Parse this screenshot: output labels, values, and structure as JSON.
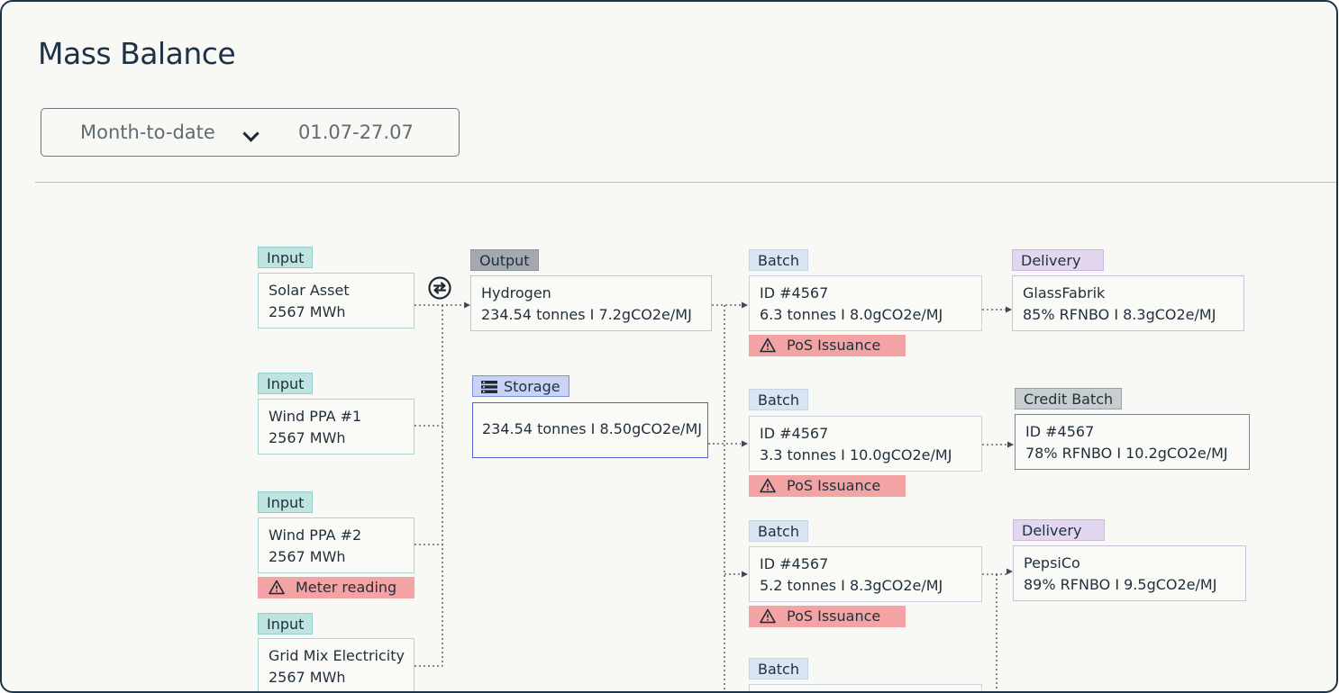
{
  "page": {
    "title": "Mass Balance"
  },
  "filter": {
    "period": "Month-to-date",
    "range": "01.07-27.07"
  },
  "inputs": [
    {
      "tag": "Input",
      "name": "Solar Asset",
      "value": "2567 MWh"
    },
    {
      "tag": "Input",
      "name": "Wind PPA #1",
      "value": "2567 MWh"
    },
    {
      "tag": "Input",
      "name": "Wind PPA #2",
      "value": "2567 MWh",
      "alert": "Meter reading"
    },
    {
      "tag": "Input",
      "name": "Grid Mix Electricity",
      "value": "2567 MWh"
    }
  ],
  "output": {
    "tag": "Output",
    "name": "Hydrogen",
    "value": "234.54 tonnes I 7.2gCO2e/MJ"
  },
  "storage": {
    "tag": "Storage",
    "value": "234.54 tonnes I 8.50gCO2e/MJ"
  },
  "batches": [
    {
      "tag": "Batch",
      "id": "ID #4567",
      "value": "6.3 tonnes I 8.0gCO2e/MJ",
      "alert": "PoS Issuance"
    },
    {
      "tag": "Batch",
      "id": "ID #4567",
      "value": "3.3 tonnes I 10.0gCO2e/MJ",
      "alert": "PoS Issuance"
    },
    {
      "tag": "Batch",
      "id": "ID #4567",
      "value": "5.2 tonnes I 8.3gCO2e/MJ",
      "alert": "PoS Issuance"
    },
    {
      "tag": "Batch"
    }
  ],
  "deliveries": [
    {
      "tag": "Delivery",
      "name": "GlassFabrik",
      "value": "85% RFNBO I 8.3gCO2e/MJ"
    },
    {
      "tag": "Credit Batch",
      "name": "ID #4567",
      "value": "78% RFNBO I 10.2gCO2e/MJ"
    },
    {
      "tag": "Delivery",
      "name": "PepsiCo",
      "value": "89% RFNBO I 9.5gCO2e/MJ"
    }
  ],
  "colors": {
    "input": "#bfe3e0",
    "output": "#a4a9b0",
    "batch": "#d9e5f2",
    "delivery": "#e3d7ef",
    "credit": "#c8cdd0",
    "storage": "#c9d3f6",
    "alert": "#f3a3a3"
  },
  "icons": {
    "swap": "swap-arrows-icon",
    "storage": "storage-icon",
    "alert": "warning-triangle-icon",
    "chevron": "chevron-down-icon"
  }
}
